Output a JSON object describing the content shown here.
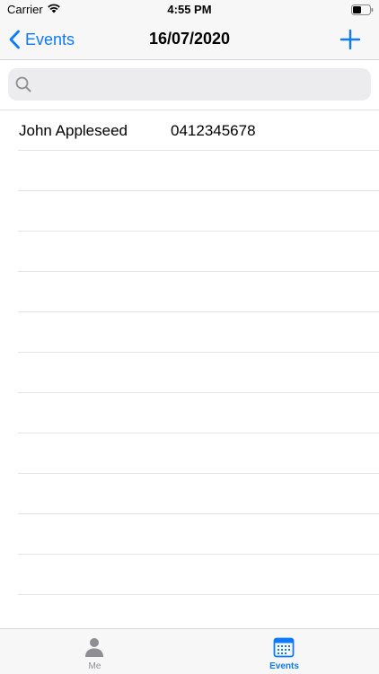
{
  "status_bar": {
    "carrier": "Carrier",
    "time": "4:55 PM",
    "icons": [
      "wifi-icon",
      "battery-icon"
    ]
  },
  "nav_bar": {
    "back_label": "Events",
    "title": "16/07/2020",
    "add_icon": "plus-icon"
  },
  "search": {
    "placeholder": "",
    "value": ""
  },
  "list": {
    "rows": [
      {
        "name": "John Appleseed",
        "phone": "0412345678"
      },
      {
        "name": "",
        "phone": ""
      },
      {
        "name": "",
        "phone": ""
      },
      {
        "name": "",
        "phone": ""
      },
      {
        "name": "",
        "phone": ""
      },
      {
        "name": "",
        "phone": ""
      },
      {
        "name": "",
        "phone": ""
      },
      {
        "name": "",
        "phone": ""
      },
      {
        "name": "",
        "phone": ""
      },
      {
        "name": "",
        "phone": ""
      },
      {
        "name": "",
        "phone": ""
      },
      {
        "name": "",
        "phone": ""
      }
    ]
  },
  "tab_bar": {
    "tabs": [
      {
        "label": "Me",
        "icon": "person-icon",
        "selected": false
      },
      {
        "label": "Events",
        "icon": "calendar-icon",
        "selected": true
      }
    ]
  },
  "colors": {
    "accent": "#0a7aff",
    "inactive": "#8e8e93",
    "bar_background": "#f7f7f7",
    "search_background": "#ececef"
  }
}
